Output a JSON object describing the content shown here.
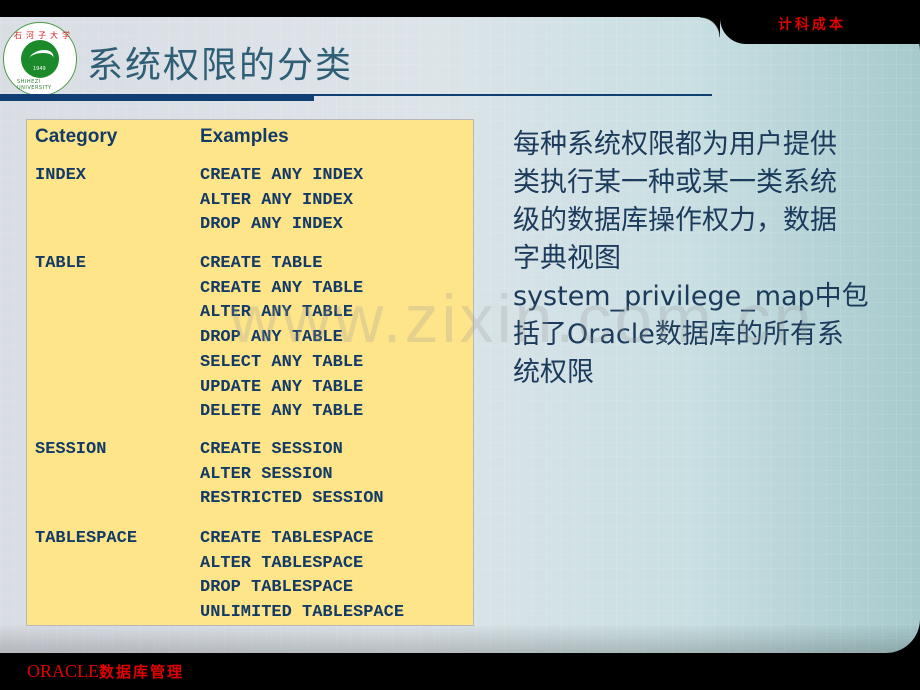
{
  "header": {
    "label": "计科成本",
    "title": "系统权限的分类"
  },
  "logo": {
    "top_text": "石河子大学",
    "bottom_text": "SHIHEZI UNIVERSITY",
    "year": "1949"
  },
  "table": {
    "headers": {
      "category": "Category",
      "examples": "Examples"
    },
    "groups": [
      {
        "category": "INDEX",
        "examples": [
          "CREATE ANY INDEX",
          "ALTER ANY INDEX",
          "DROP ANY INDEX"
        ]
      },
      {
        "category": "TABLE",
        "examples": [
          "CREATE TABLE",
          "CREATE ANY TABLE",
          "ALTER ANY TABLE",
          "DROP ANY TABLE",
          "SELECT ANY TABLE",
          "UPDATE ANY TABLE",
          "DELETE ANY TABLE"
        ]
      },
      {
        "category": "SESSION",
        "examples": [
          "CREATE SESSION",
          "ALTER SESSION",
          "RESTRICTED SESSION"
        ]
      },
      {
        "category": "TABLESPACE",
        "examples": [
          "CREATE TABLESPACE",
          "ALTER TABLESPACE",
          "DROP TABLESPACE",
          "UNLIMITED TABLESPACE"
        ]
      }
    ]
  },
  "description": {
    "lines": [
      "每种系统权限都为用户提供",
      "类执行某一种或某一类系统",
      "级的数据库操作权力，数据",
      "字典视图",
      "system_privilege_map中包",
      "括了Oracle数据库的所有系",
      "统权限"
    ]
  },
  "watermark": "www.zixin.com.cn",
  "footer": {
    "label_latin": "ORACLE",
    "label_cn": "数据库管理"
  },
  "colors": {
    "title": "#2f5f77",
    "table_bg": "#fee58a",
    "table_text": "#143a66",
    "accent_red": "#e00000",
    "rule": "#0f3f73"
  }
}
